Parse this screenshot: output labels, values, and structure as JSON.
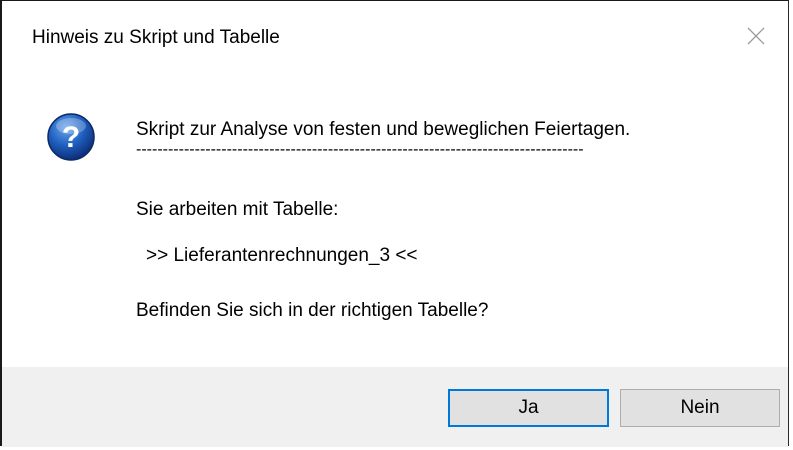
{
  "window": {
    "title": "Hinweis zu Skript und Tabelle",
    "close_icon": "close-icon"
  },
  "message": {
    "icon": "question-icon",
    "line1": "Skript zur Analyse von festen und beweglichen Feiertagen.",
    "separator": "------------------------------------------------------------------------------------",
    "line3": "Sie arbeiten mit Tabelle:",
    "table_line": ">>  Lieferantenrechnungen_3  <<",
    "question": "Befinden Sie sich in der richtigen Tabelle?"
  },
  "buttons": {
    "yes_label": "Ja",
    "no_label": "Nein"
  },
  "colors": {
    "focus_border": "#0078d7",
    "footer_bg": "#f0f0f0",
    "button_bg": "#e1e1e1",
    "icon_blue": "#1d4ea0"
  }
}
